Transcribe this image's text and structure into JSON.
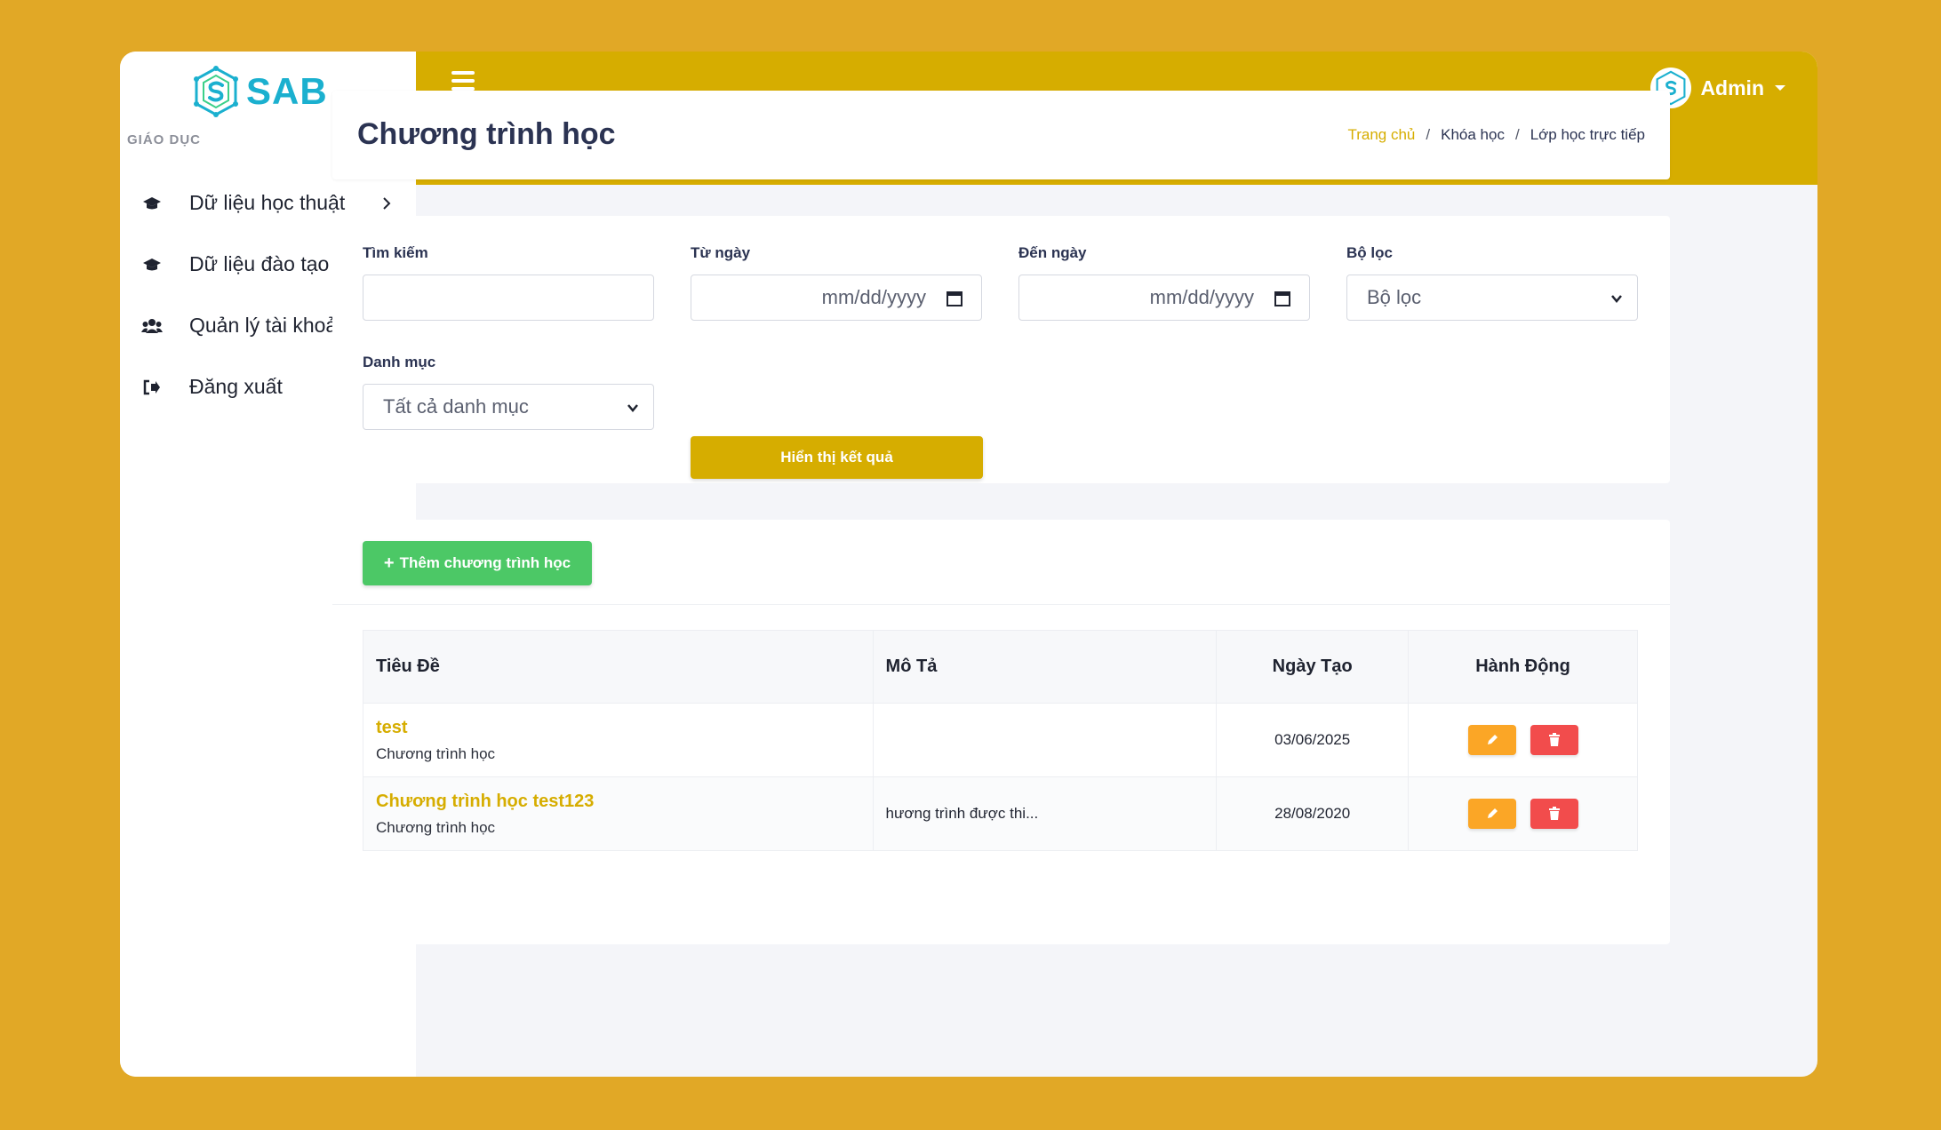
{
  "sidebar": {
    "logo_text": "SAB",
    "section_heading": "GIÁO DỤC",
    "items": [
      {
        "label": "Dữ liệu học thuật",
        "icon": "graduation-cap-icon",
        "has_children": true
      },
      {
        "label": "Dữ liệu đào tạo",
        "icon": "graduation-cap-icon",
        "has_children": true
      },
      {
        "label": "Quản lý tài khoản",
        "icon": "users-icon",
        "has_children": true
      },
      {
        "label": "Đăng xuất",
        "icon": "sign-out-icon",
        "has_children": false
      }
    ]
  },
  "topbar": {
    "user_name": "Admin",
    "menu_icon": "hamburger-icon"
  },
  "header": {
    "title": "Chương trình học",
    "breadcrumb": [
      "Trang chủ",
      "Khóa học",
      "Lớp học trực tiếp"
    ]
  },
  "filters": {
    "search_label": "Tìm kiếm",
    "search_value": "",
    "from_label": "Từ ngày",
    "from_placeholder": "mm/dd/yyyy",
    "to_label": "Đến ngày",
    "to_placeholder": "mm/dd/yyyy",
    "filter_label": "Bộ lọc",
    "filter_selected": "Bộ lọc",
    "category_label": "Danh mục",
    "category_selected": "Tất cả danh mục",
    "submit_label": "Hiển thị kết quả"
  },
  "list": {
    "add_label": "Thêm chương trình học",
    "columns": [
      "Tiêu Đề",
      "Mô Tả",
      "Ngày Tạo",
      "Hành Động"
    ],
    "rows": [
      {
        "title": "test",
        "category": "Chương trình học",
        "description": "",
        "created": "03/06/2025"
      },
      {
        "title": "Chương trình học test123",
        "category": "Chương trình học",
        "description": "hương trình được thi...",
        "created": "28/08/2020"
      }
    ]
  },
  "colors": {
    "accent": "#d6ad00",
    "background": "#e1a826",
    "add_button": "#4cc866",
    "edit_button": "#fba626",
    "delete_button": "#f24c4c"
  }
}
